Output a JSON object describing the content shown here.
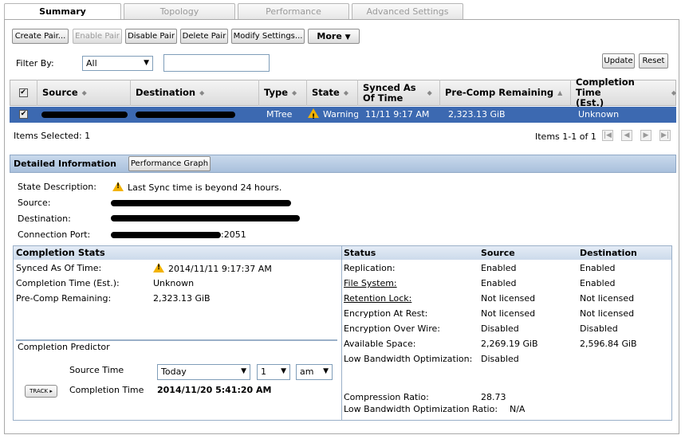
{
  "tabs": [
    {
      "label": "Summary",
      "active": true
    },
    {
      "label": "Topology",
      "active": false
    },
    {
      "label": "Performance",
      "active": false
    },
    {
      "label": "Advanced Settings",
      "active": false
    }
  ],
  "toolbar": {
    "create_pair": "Create Pair...",
    "enable_pair": "Enable Pair",
    "disable_pair": "Disable Pair",
    "delete_pair": "Delete Pair",
    "modify_settings": "Modify Settings...",
    "more": "More"
  },
  "filter": {
    "label": "Filter By:",
    "field_value": "All",
    "text_value": "",
    "update": "Update",
    "reset": "Reset"
  },
  "table": {
    "columns": {
      "source": "Source",
      "destination": "Destination",
      "type": "Type",
      "state": "State",
      "synced_line1": "Synced As",
      "synced_line2": "Of Time",
      "precomp": "Pre-Comp Remaining",
      "completion_line1": "Completion Time",
      "completion_line2": "(Est.)"
    },
    "rows": [
      {
        "type": "MTree",
        "state": "Warning",
        "synced": "11/11 9:17 AM",
        "precomp": "2,323.13 GiB",
        "completion": "Unknown"
      }
    ],
    "items_selected": "Items Selected: 1",
    "items_range": "Items 1-1 of 1"
  },
  "details": {
    "title": "Detailed Information",
    "perf_graph_button": "Performance Graph",
    "state_description_label": "State Description:",
    "state_description": "Last Sync time is beyond 24 hours.",
    "source_label": "Source:",
    "destination_label": "Destination:",
    "connection_port_label": "Connection Port:",
    "connection_port_suffix": ":2051"
  },
  "completion_stats": {
    "title": "Completion Stats",
    "synced_label": "Synced As Of Time:",
    "synced_value": "2014/11/11 9:17:37 AM",
    "completion_label": "Completion Time (Est.):",
    "completion_value": "Unknown",
    "precomp_label": "Pre-Comp Remaining:",
    "precomp_value": "2,323.13 GiB"
  },
  "predictor": {
    "title": "Completion Predictor",
    "source_time_label": "Source Time",
    "day_value": "Today",
    "hour_value": "1",
    "ampm_value": "am",
    "track_label": "TRACK",
    "completion_time_label": "Completion Time",
    "completion_time_value": "2014/11/20 5:41:20 AM"
  },
  "status": {
    "headers": {
      "status": "Status",
      "source": "Source",
      "destination": "Destination"
    },
    "rows": [
      {
        "label": "Replication:",
        "source": "Enabled",
        "destination": "Enabled",
        "link": false
      },
      {
        "label": "File System:",
        "source": "Enabled",
        "destination": "Enabled",
        "link": true
      },
      {
        "label": "Retention Lock:",
        "source": "Not licensed",
        "destination": "Not licensed",
        "link": true
      },
      {
        "label": "Encryption At Rest:",
        "source": "Not licensed",
        "destination": "Not licensed",
        "link": false
      },
      {
        "label": "Encryption Over Wire:",
        "source": "Disabled",
        "destination": "Disabled",
        "link": false
      },
      {
        "label": "Available Space:",
        "source": "2,269.19 GiB",
        "destination": "2,596.84 GiB",
        "link": false
      },
      {
        "label": "Low Bandwidth Optimization:",
        "source": "Disabled",
        "destination": "",
        "link": false
      }
    ],
    "compression_label": "Compression Ratio:",
    "compression_value": "28.73",
    "lbo_ratio_label": "Low Bandwidth Optimization Ratio:",
    "lbo_ratio_value": "N/A"
  },
  "colors": {
    "selected_row": "#3c69b1",
    "warning": "#f2b200",
    "detail_bar": "#b9cde4"
  }
}
